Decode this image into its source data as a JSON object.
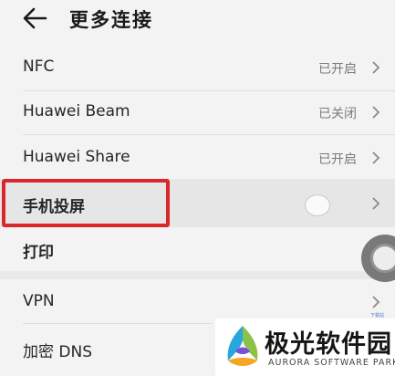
{
  "header": {
    "title": "更多连接",
    "back_icon": "back-arrow-icon"
  },
  "rows": [
    {
      "label": "NFC",
      "value": "已开启"
    },
    {
      "label": "Huawei Beam",
      "value": "已关闭"
    },
    {
      "label": "Huawei Share",
      "value": "已开启"
    },
    {
      "label": "手机投屏",
      "value": ""
    },
    {
      "label": "打印",
      "value": ""
    },
    {
      "label": "VPN",
      "value": ""
    },
    {
      "label": "加密 DNS",
      "value": ""
    }
  ],
  "watermark": {
    "title": "极光软件园",
    "subtitle": "AURORA SOFTWARE PARK",
    "tag": "下载站"
  },
  "colors": {
    "background": "#f3f3f3",
    "highlight_border": "#d9272c",
    "secondary_text": "#7a7a7a"
  }
}
